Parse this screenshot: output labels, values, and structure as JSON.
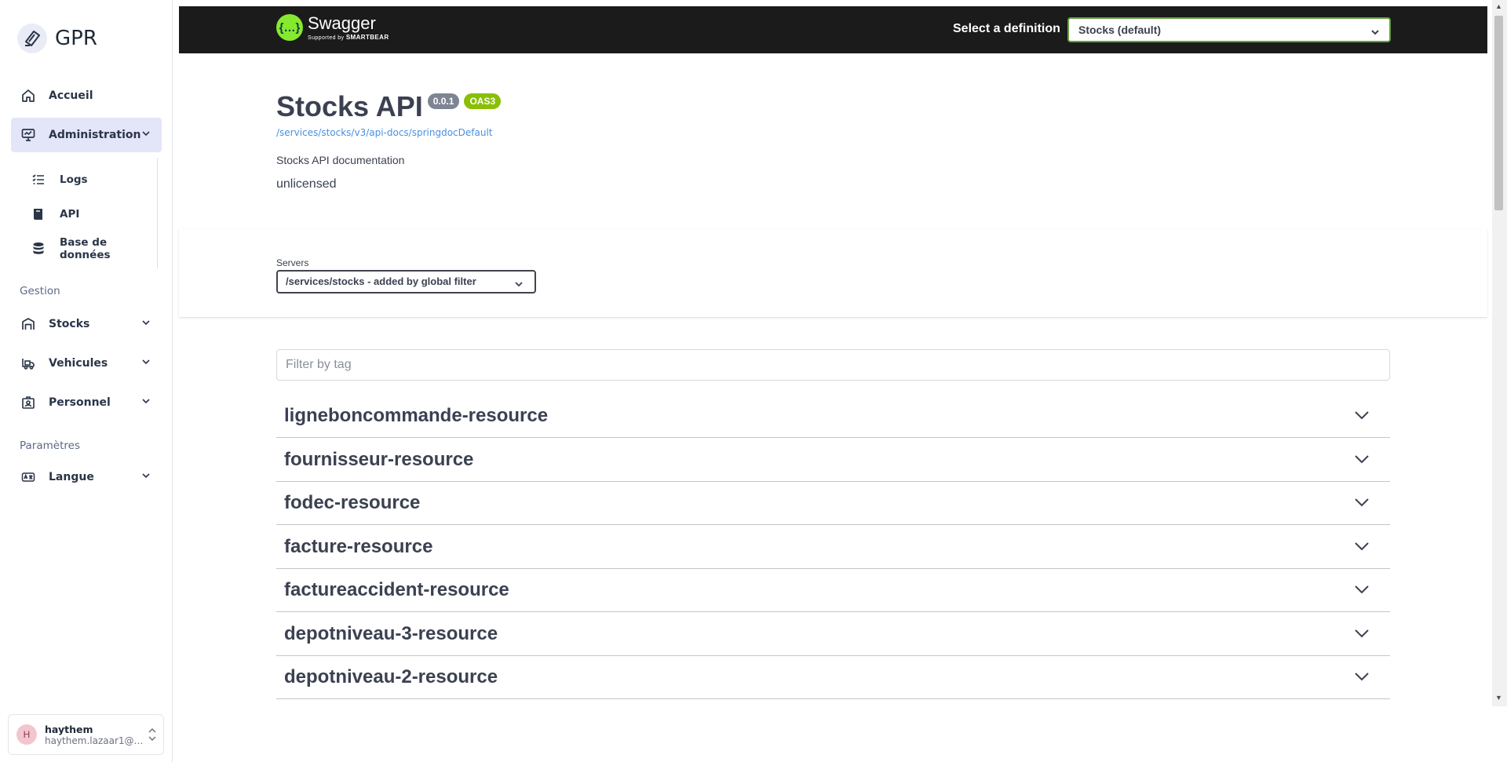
{
  "sidebar": {
    "brand": "GPR",
    "nav": [
      {
        "label": "Accueil",
        "icon": "home-icon"
      },
      {
        "label": "Administration",
        "icon": "monitor-icon",
        "active": true
      }
    ],
    "admin_children": [
      {
        "label": "Logs",
        "icon": "list-icon"
      },
      {
        "label": "API",
        "icon": "book-icon"
      },
      {
        "label": "Base de données",
        "icon": "database-icon"
      }
    ],
    "section_gestion": "Gestion",
    "gestion_items": [
      {
        "label": "Stocks",
        "icon": "warehouse-icon"
      },
      {
        "label": "Vehicules",
        "icon": "truck-icon"
      },
      {
        "label": "Personnel",
        "icon": "badge-icon"
      }
    ],
    "section_params": "Paramètres",
    "params_items": [
      {
        "label": "Langue",
        "icon": "language-icon"
      }
    ],
    "user": {
      "initial": "H",
      "name": "haythem",
      "email": "haythem.lazaar1@gm..."
    }
  },
  "swagger": {
    "brand": "Swagger",
    "brand_sub_prefix": "Supported by",
    "brand_sub": "SMARTBEAR",
    "definition_label": "Select a definition",
    "definition_value": "Stocks (default)",
    "title": "Stocks API",
    "version": "0.0.1",
    "oas": "OAS3",
    "url": "/services/stocks/v3/api-docs/springdocDefault",
    "description": "Stocks API documentation",
    "license": "unlicensed",
    "servers_label": "Servers",
    "servers_value": "/services/stocks - added by global filter",
    "filter_placeholder": "Filter by tag",
    "tags": [
      "ligneboncommande-resource",
      "fournisseur-resource",
      "fodec-resource",
      "facture-resource",
      "factureaccident-resource",
      "depotniveau-3-resource",
      "depotniveau-2-resource"
    ]
  },
  "colors": {
    "topbar": "#1b1b1b",
    "swagger_green": "#85ea2d",
    "oas_badge": "#89bf04",
    "version_badge": "#7d8492",
    "link": "#4990e2",
    "sidebar_active": "#e3e6f8"
  }
}
